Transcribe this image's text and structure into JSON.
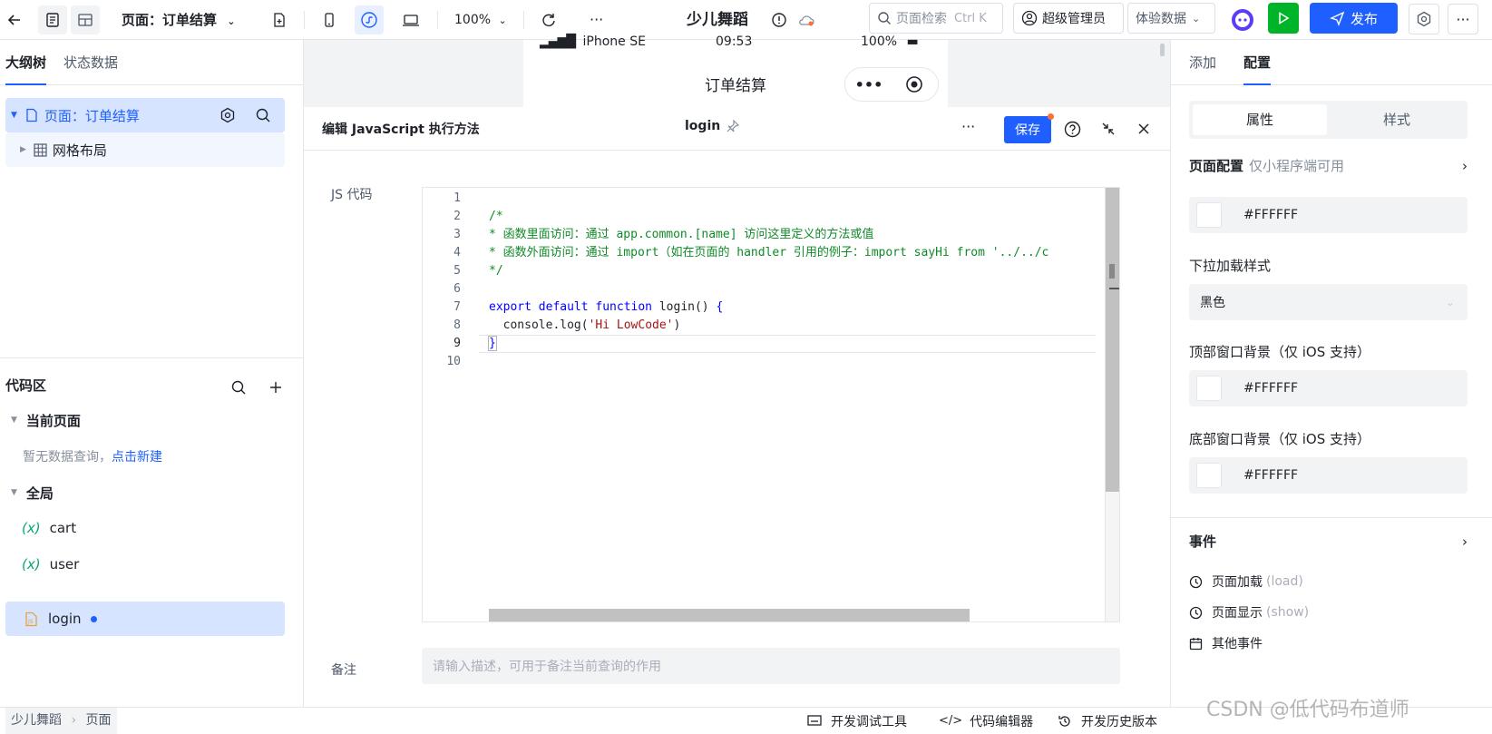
{
  "topbar": {
    "page_selector": "页面：订单结算",
    "zoom": "100%",
    "app_name": "少儿舞蹈",
    "search_placeholder": "页面检索",
    "search_shortcut": "Ctrl K",
    "user_role": "超级管理员",
    "data_mode": "体验数据",
    "publish_label": "发布",
    "more": "···"
  },
  "left": {
    "tabs": [
      "大纲树",
      "状态数据"
    ],
    "tree": [
      {
        "label": "页面：订单结算"
      },
      {
        "label": "网格布局"
      }
    ],
    "code_area": {
      "title": "代码区",
      "current_page": "当前页面",
      "empty_text": "暂无数据查询，",
      "create_link": "点击新建",
      "global": "全局",
      "items": [
        {
          "label": "cart",
          "type": "variable"
        },
        {
          "label": "user",
          "type": "variable"
        },
        {
          "label": "login",
          "type": "js"
        }
      ]
    }
  },
  "preview": {
    "device": "iPhone SE",
    "time": "09:53",
    "battery": "100%",
    "page_title": "订单结算"
  },
  "editor": {
    "title": "编辑 JavaScript 执行方法",
    "method_name": "login",
    "save_label": "保存",
    "more": "···",
    "js_label": "JS 代码",
    "remark_label": "备注",
    "remark_placeholder": "请输入描述，可用于备注当前查询的作用",
    "lines": [
      "1",
      "2",
      "3",
      "4",
      "5",
      "6",
      "7",
      "8",
      "9",
      "10"
    ]
  },
  "right": {
    "tabs": [
      "添加",
      "配置"
    ],
    "segments": [
      "属性",
      "样式"
    ],
    "page_config": "页面配置",
    "page_config_hint": "仅小程序端可用",
    "bg_color": "#FFFFFF",
    "pull_style_label": "下拉加载样式",
    "pull_style_value": "黑色",
    "top_bg_label": "顶部窗口背景（仅 iOS 支持）",
    "top_bg_color": "#FFFFFF",
    "bottom_bg_label": "底部窗口背景（仅 iOS 支持）",
    "bottom_bg_color": "#FFFFFF",
    "events_title": "事件",
    "events": [
      {
        "label": "页面加载",
        "code": "(load)"
      },
      {
        "label": "页面显示",
        "code": "(show)"
      },
      {
        "label": "其他事件",
        "code": ""
      }
    ]
  },
  "bottombar": {
    "breadcrumb": [
      "少儿舞蹈",
      "页面"
    ],
    "debug_tool": "开发调试工具",
    "code_editor": "代码编辑器",
    "history": "开发历史版本",
    "watermark": "CSDN @低代码布道师"
  },
  "colors": {
    "accent": "#1f5fff",
    "run_green": "#00b42a",
    "selected_bg": "#d6e4ff"
  }
}
